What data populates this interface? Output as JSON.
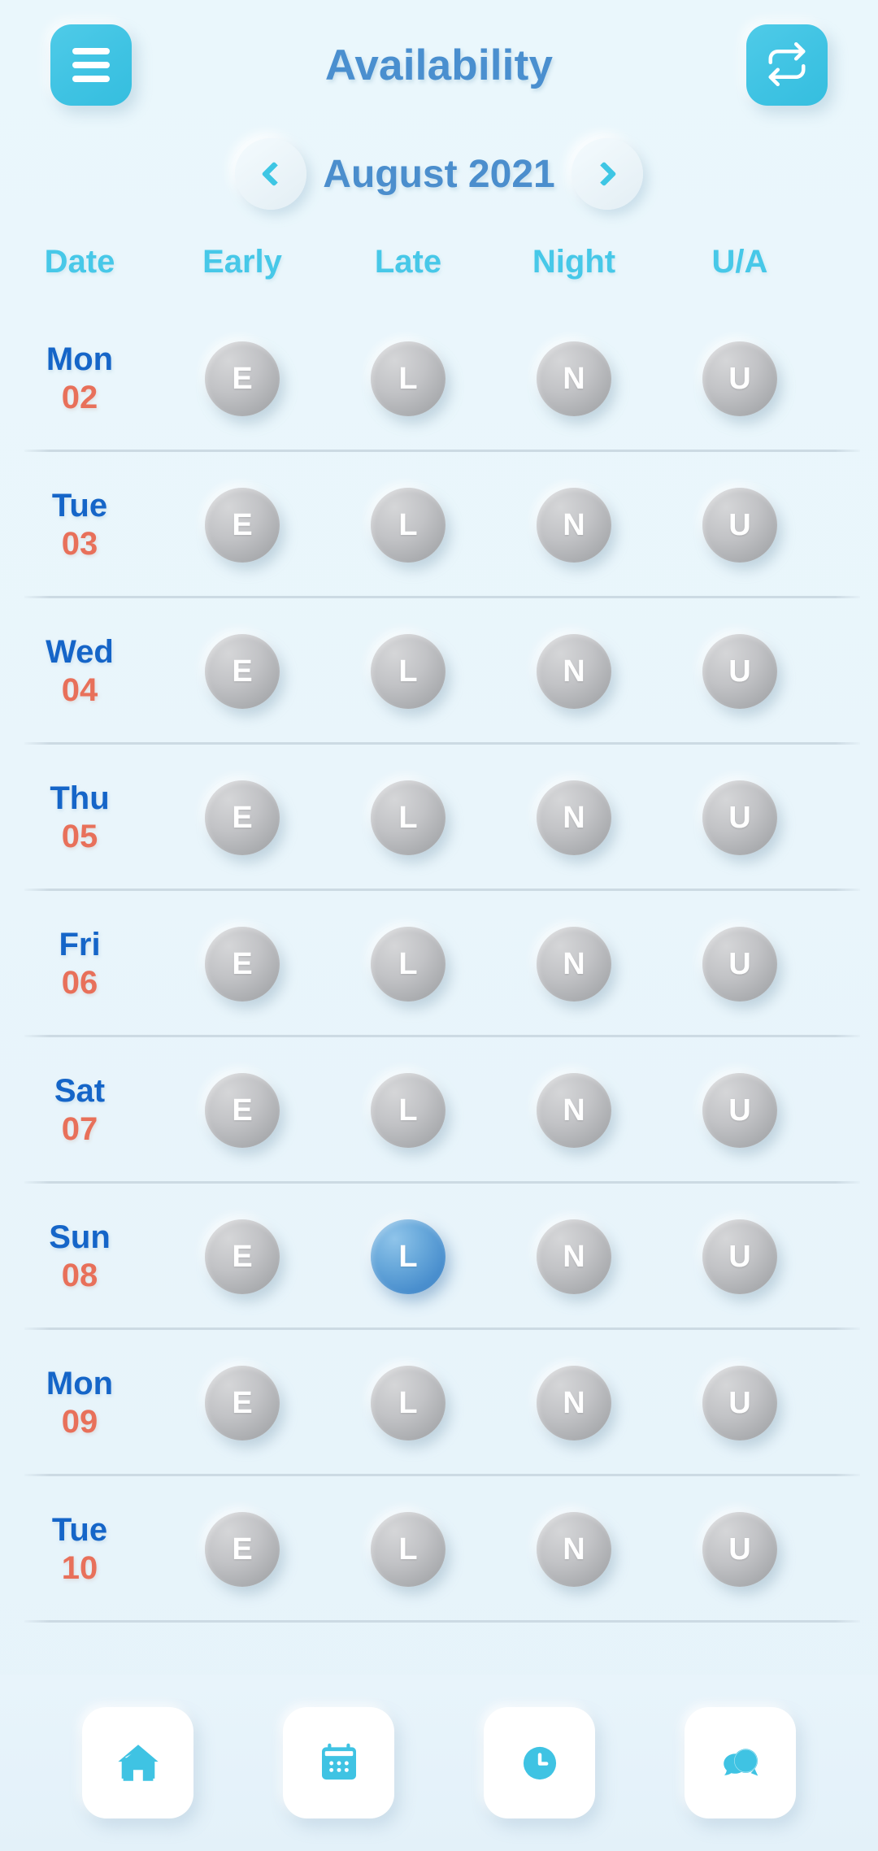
{
  "header": {
    "title": "Availability",
    "menu_icon": "hamburger-menu-icon",
    "sync_icon": "repeat-sync-icon",
    "accent": "#3fc3e3",
    "title_color": "#4a8fcf"
  },
  "month_nav": {
    "label": "August 2021",
    "prev_icon": "chevron-left-icon",
    "next_icon": "chevron-right-icon",
    "chevron_color": "#3ec6e4"
  },
  "table": {
    "columns": [
      "Date",
      "Early",
      "Late",
      "Night",
      "U/A"
    ],
    "header_color": "#47c8e8",
    "slot_keys": [
      "E",
      "L",
      "N",
      "U"
    ],
    "day_color": "#1565c8",
    "date_color": "#e8705a",
    "badge_off_color": "#b4b6b9",
    "badge_on_color": "#4a8fce",
    "rows": [
      {
        "dow": "Mon",
        "date": "02",
        "slots": [
          {
            "label": "E",
            "selected": false
          },
          {
            "label": "L",
            "selected": false
          },
          {
            "label": "N",
            "selected": false
          },
          {
            "label": "U",
            "selected": false
          }
        ]
      },
      {
        "dow": "Tue",
        "date": "03",
        "slots": [
          {
            "label": "E",
            "selected": false
          },
          {
            "label": "L",
            "selected": false
          },
          {
            "label": "N",
            "selected": false
          },
          {
            "label": "U",
            "selected": false
          }
        ]
      },
      {
        "dow": "Wed",
        "date": "04",
        "slots": [
          {
            "label": "E",
            "selected": false
          },
          {
            "label": "L",
            "selected": false
          },
          {
            "label": "N",
            "selected": false
          },
          {
            "label": "U",
            "selected": false
          }
        ]
      },
      {
        "dow": "Thu",
        "date": "05",
        "slots": [
          {
            "label": "E",
            "selected": false
          },
          {
            "label": "L",
            "selected": false
          },
          {
            "label": "N",
            "selected": false
          },
          {
            "label": "U",
            "selected": false
          }
        ]
      },
      {
        "dow": "Fri",
        "date": "06",
        "slots": [
          {
            "label": "E",
            "selected": false
          },
          {
            "label": "L",
            "selected": false
          },
          {
            "label": "N",
            "selected": false
          },
          {
            "label": "U",
            "selected": false
          }
        ]
      },
      {
        "dow": "Sat",
        "date": "07",
        "slots": [
          {
            "label": "E",
            "selected": false
          },
          {
            "label": "L",
            "selected": false
          },
          {
            "label": "N",
            "selected": false
          },
          {
            "label": "U",
            "selected": false
          }
        ]
      },
      {
        "dow": "Sun",
        "date": "08",
        "slots": [
          {
            "label": "E",
            "selected": false
          },
          {
            "label": "L",
            "selected": true
          },
          {
            "label": "N",
            "selected": false
          },
          {
            "label": "U",
            "selected": false
          }
        ]
      },
      {
        "dow": "Mon",
        "date": "09",
        "slots": [
          {
            "label": "E",
            "selected": false
          },
          {
            "label": "L",
            "selected": false
          },
          {
            "label": "N",
            "selected": false
          },
          {
            "label": "U",
            "selected": false
          }
        ]
      },
      {
        "dow": "Tue",
        "date": "10",
        "slots": [
          {
            "label": "E",
            "selected": false
          },
          {
            "label": "L",
            "selected": false
          },
          {
            "label": "N",
            "selected": false
          },
          {
            "label": "U",
            "selected": false
          }
        ]
      }
    ]
  },
  "bottom_nav": {
    "icon_color": "#3fc3e3",
    "items": [
      {
        "name": "home-icon",
        "label": "Home"
      },
      {
        "name": "calendar-icon",
        "label": "Calendar"
      },
      {
        "name": "clock-icon",
        "label": "Clock"
      },
      {
        "name": "chat-icon",
        "label": "Chat"
      }
    ]
  },
  "page_background": "#e9f5fb"
}
